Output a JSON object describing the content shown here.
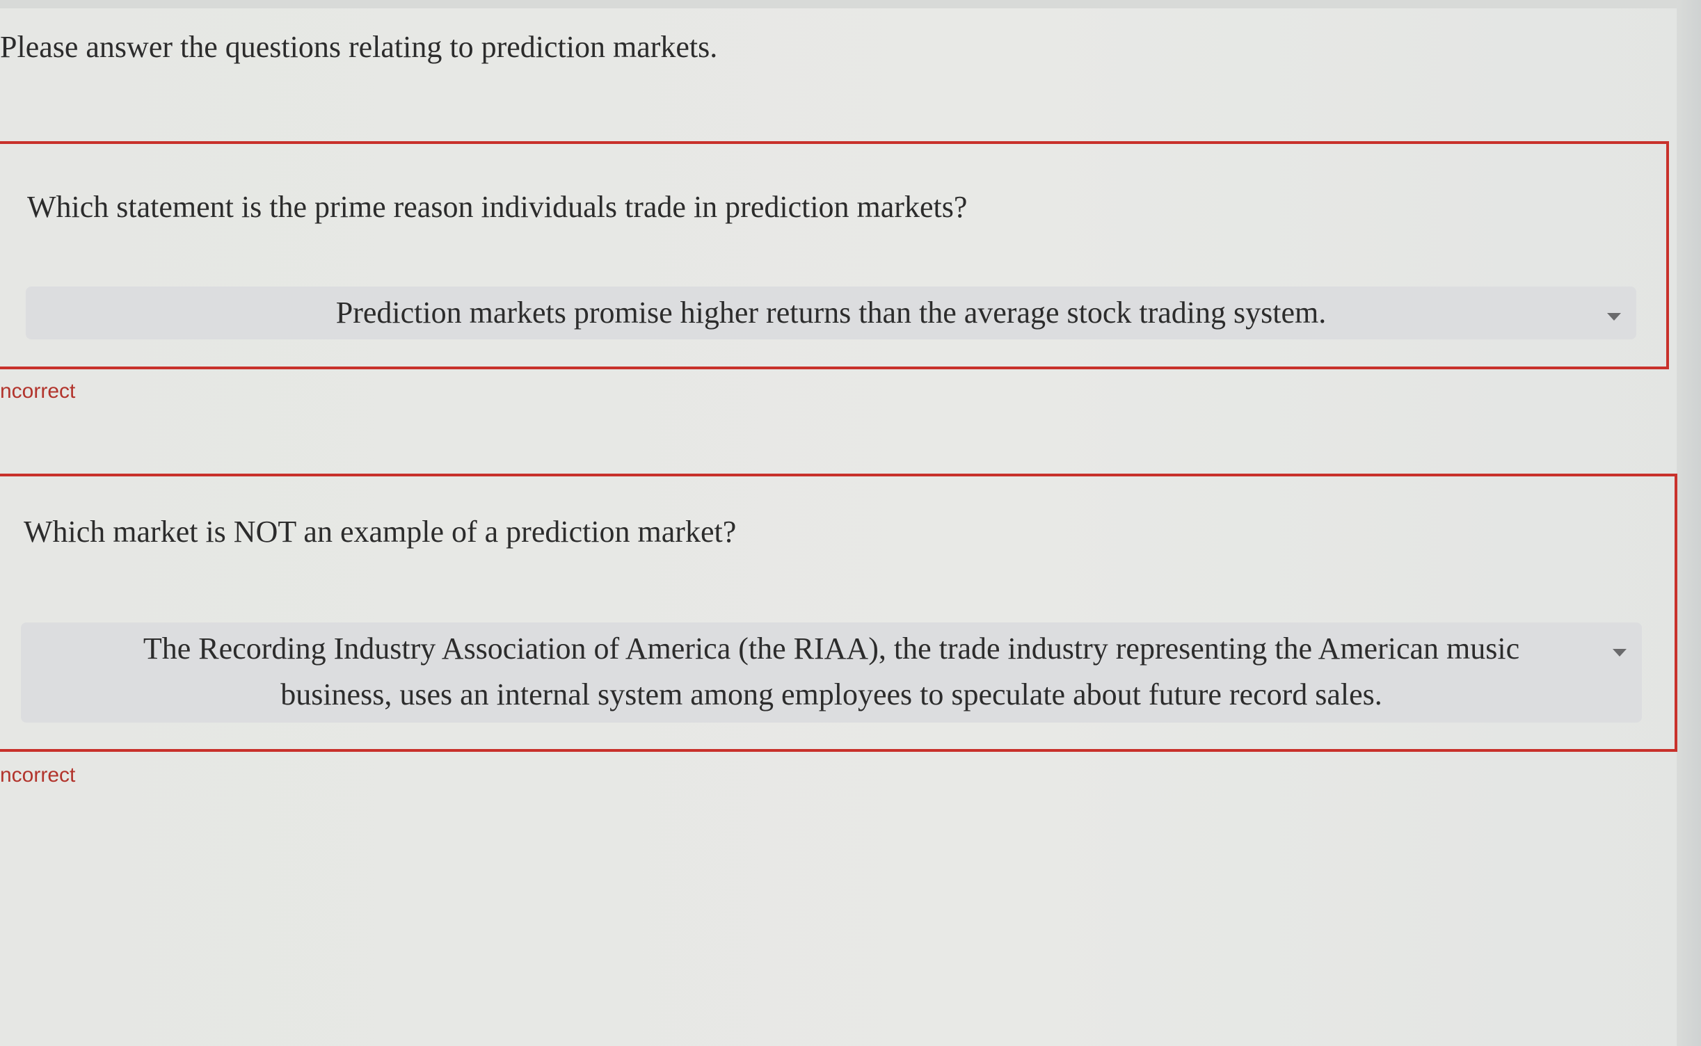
{
  "instructions": "Please answer the questions relating to prediction markets.",
  "questions": [
    {
      "prompt": "Which statement is the prime reason individuals trade in prediction markets?",
      "selected_answer": "Prediction markets promise higher returns than the average stock trading system.",
      "result": "ncorrect"
    },
    {
      "prompt": "Which market is NOT an example of a prediction market?",
      "selected_answer": "The Recording Industry Association of America (the RIAA), the trade industry representing the American music business, uses an internal system among employees to speculate about future record sales.",
      "result": "ncorrect"
    }
  ],
  "icons": {
    "dropdown": "chevron-down-icon"
  },
  "colors": {
    "error_border": "#c8312b",
    "error_text": "#b2342c",
    "select_background": "#dcdddf",
    "page_background": "#e7e8e5"
  }
}
